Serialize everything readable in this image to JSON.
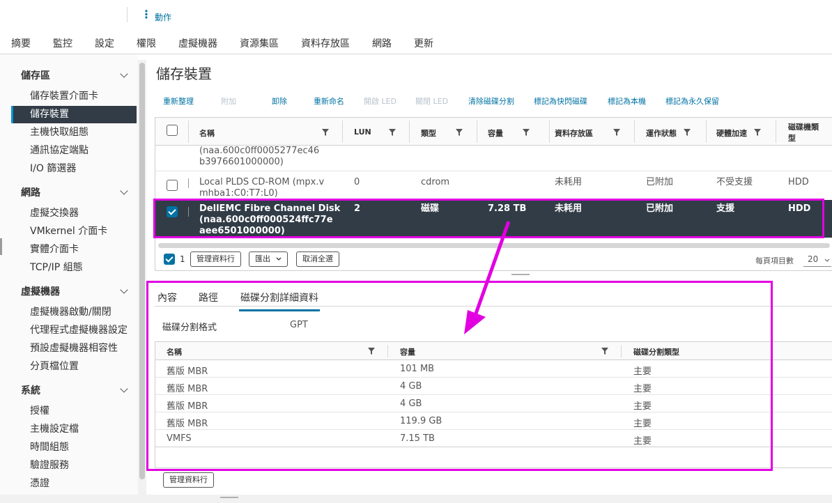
{
  "header": {
    "actions_label": "動作"
  },
  "tabs": [
    "摘要",
    "監控",
    "設定",
    "權限",
    "虛擬機器",
    "資源集區",
    "資料存放區",
    "網路",
    "更新"
  ],
  "active_tab": "設定",
  "sidebar": {
    "groups": [
      {
        "title": "儲存區",
        "items": [
          "儲存裝置介面卡",
          "儲存裝置",
          "主機快取組態",
          "通訊協定端點",
          "I/O 篩選器"
        ]
      },
      {
        "title": "網路",
        "items": [
          "虛擬交換器",
          "VMkernel 介面卡",
          "實體介面卡",
          "TCP/IP 組態"
        ]
      },
      {
        "title": "虛擬機器",
        "items": [
          "虛擬機器啟動/關閉",
          "代理程式虛擬機器設定",
          "預設虛擬機器相容性",
          "分頁檔位置"
        ]
      },
      {
        "title": "系統",
        "items": [
          "授權",
          "主機設定檔",
          "時間組態",
          "驗證服務",
          "憑證"
        ]
      }
    ],
    "active_item": "儲存裝置"
  },
  "page": {
    "title": "儲存裝置"
  },
  "toolbar": {
    "rescan": "重新整理",
    "attach": "附加",
    "detach": "卸除",
    "rename": "重新命名",
    "led_on": "開啟 LED",
    "led_off": "關閉 LED",
    "clear_partitions": "清除磁碟分割",
    "mark_flash": "標記為快閃磁碟",
    "mark_local": "標記為本機",
    "mark_perennial": "標記為永久保留"
  },
  "devices": {
    "columns": [
      "名稱",
      "LUN",
      "類型",
      "容量",
      "資料存放區",
      "運作狀態",
      "硬體加速",
      "磁碟機類型"
    ],
    "rows": [
      {
        "name_line1": "(naa.600c0ff0005277ec46",
        "name_line2": "b3976601000000)",
        "lun": "",
        "type": "",
        "capacity": "",
        "datastore": "",
        "status": "",
        "hw_accel": "",
        "drive_type": "",
        "selected": false
      },
      {
        "name_line1": "Local PLDS CD-ROM (mpx.v",
        "name_line2": "mhba1:C0:T7:L0)",
        "name_line3": "",
        "lun": "0",
        "type": "cdrom",
        "capacity": "",
        "datastore": "未耗用",
        "status": "已附加",
        "hw_accel": "不受支援",
        "drive_type": "HDD",
        "selected": false
      },
      {
        "name_line1": "DellEMC Fibre Channel Disk",
        "name_line2": "(naa.600c0ff000524ffc77e",
        "name_line3": "aee6501000000)",
        "lun": "2",
        "type": "磁碟",
        "capacity": "7.28 TB",
        "datastore": "未耗用",
        "status": "已附加",
        "hw_accel": "支援",
        "drive_type": "HDD",
        "selected": true
      }
    ],
    "selected_count": "1",
    "manage_columns": "管理資料行",
    "export": "匯出",
    "deselect_all": "取消全選",
    "items_per_page_label": "每頁項目數",
    "items_per_page": "20"
  },
  "detail": {
    "tabs": [
      "內容",
      "路徑",
      "磁碟分割詳細資料"
    ],
    "active_tab": "磁碟分割詳細資料",
    "partition_format_label": "磁碟分割格式",
    "partition_format": "GPT",
    "columns": [
      "名稱",
      "容量",
      "磁碟分割類型"
    ],
    "partitions": [
      {
        "name": "舊版 MBR",
        "capacity": "101 MB",
        "type": "主要"
      },
      {
        "name": "舊版 MBR",
        "capacity": "4 GB",
        "type": "主要"
      },
      {
        "name": "舊版 MBR",
        "capacity": "4 GB",
        "type": "主要"
      },
      {
        "name": "舊版 MBR",
        "capacity": "119.9 GB",
        "type": "主要"
      },
      {
        "name": "VMFS",
        "capacity": "7.15 TB",
        "type": "主要"
      }
    ],
    "manage_columns": "管理資料行"
  },
  "colors": {
    "accent": "#0072a3",
    "selected_row": "#313c47",
    "annotation": "#e200e2"
  },
  "icons": [
    "more-vertical-icon",
    "chevron-down-icon",
    "filter-icon",
    "checkbox-icon",
    "arrow-annotation"
  ]
}
